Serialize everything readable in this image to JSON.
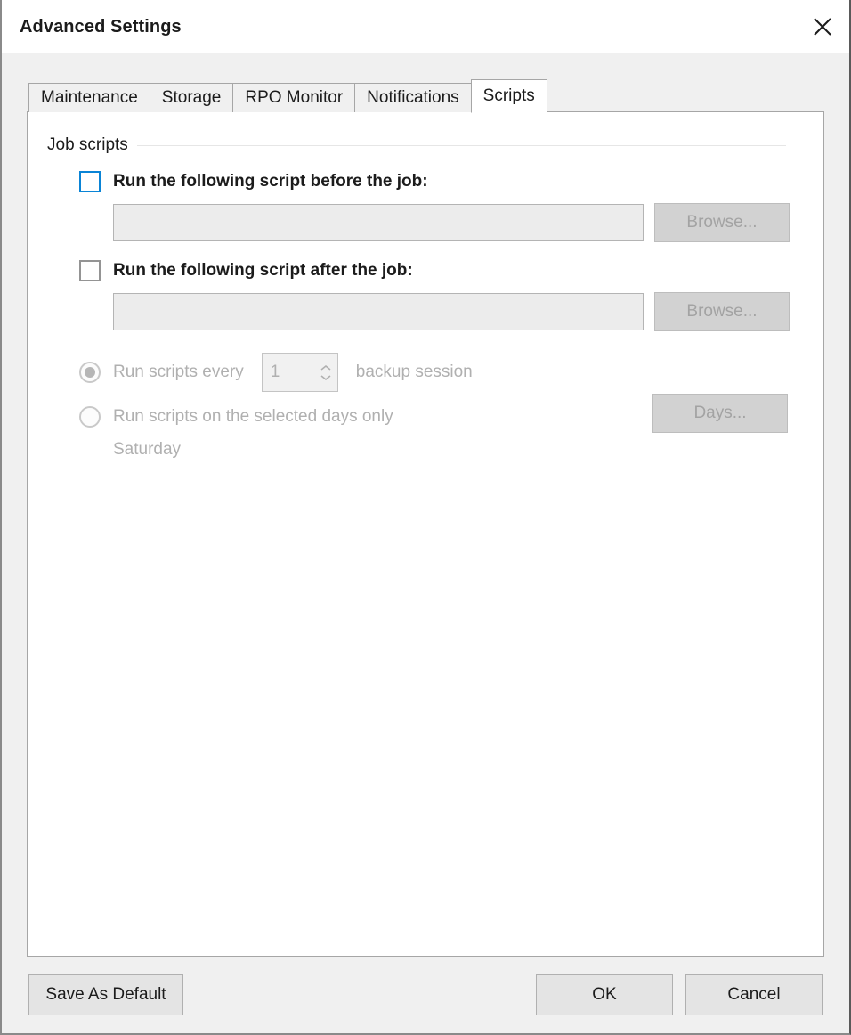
{
  "window": {
    "title": "Advanced Settings",
    "close_icon": "close-icon"
  },
  "tabs": [
    {
      "label": "Maintenance",
      "active": false
    },
    {
      "label": "Storage",
      "active": false
    },
    {
      "label": "RPO Monitor",
      "active": false
    },
    {
      "label": "Notifications",
      "active": false
    },
    {
      "label": "Scripts",
      "active": true
    }
  ],
  "scripts_tab": {
    "group_title": "Job scripts",
    "pre_job": {
      "checkbox_label": "Run the following script before the job:",
      "checked": false,
      "path_value": "",
      "path_placeholder": "",
      "browse_label": "Browse..."
    },
    "post_job": {
      "checkbox_label": "Run the following script after the job:",
      "checked": false,
      "path_value": "",
      "path_placeholder": "",
      "browse_label": "Browse..."
    },
    "frequency": {
      "every_session": {
        "label_before": "Run scripts every",
        "spinner_value": "1",
        "label_after": "backup session",
        "selected": true
      },
      "selected_days": {
        "label": "Run scripts on the selected days only",
        "selected": false,
        "days_button_label": "Days...",
        "days_summary": "Saturday"
      }
    }
  },
  "footer": {
    "save_as_default_label": "Save As Default",
    "ok_label": "OK",
    "cancel_label": "Cancel"
  },
  "colors": {
    "accent_focus": "#0a84d6",
    "dialog_bg": "#f0f0f0",
    "panel_bg": "#ffffff",
    "disabled_text": "#b0b0b0",
    "text": "#1b1b1b"
  }
}
